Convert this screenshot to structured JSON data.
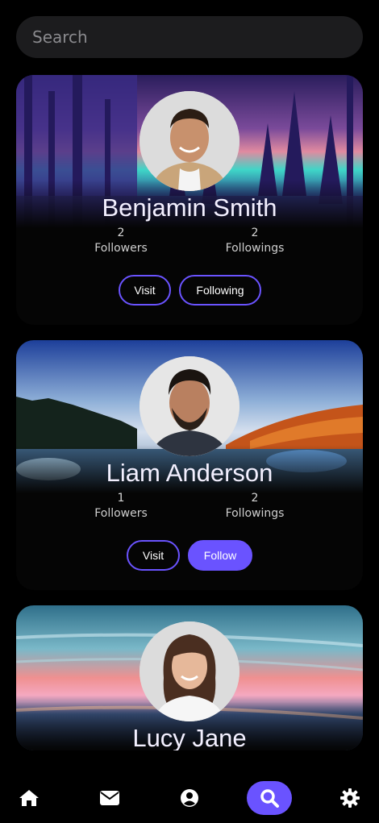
{
  "search": {
    "placeholder": "Search"
  },
  "profiles": [
    {
      "name": "Benjamin Smith",
      "followers": "2",
      "followers_label": "Followers",
      "followings": "2",
      "followings_label": "Followings",
      "visit_label": "Visit",
      "follow_label": "Following",
      "is_following": true
    },
    {
      "name": "Liam Anderson",
      "followers": "1",
      "followers_label": "Followers",
      "followings": "2",
      "followings_label": "Followings",
      "visit_label": "Visit",
      "follow_label": "Follow",
      "is_following": false
    },
    {
      "name": "Lucy Jane"
    }
  ],
  "nav": {
    "items": [
      {
        "icon": "home-icon"
      },
      {
        "icon": "mail-icon"
      },
      {
        "icon": "user-circle-icon"
      },
      {
        "icon": "search-icon",
        "active": true
      },
      {
        "icon": "gear-icon"
      }
    ]
  },
  "colors": {
    "accent": "#6a53ff",
    "background": "#000000",
    "card": "#050505",
    "search_bg": "#1c1c1e"
  }
}
